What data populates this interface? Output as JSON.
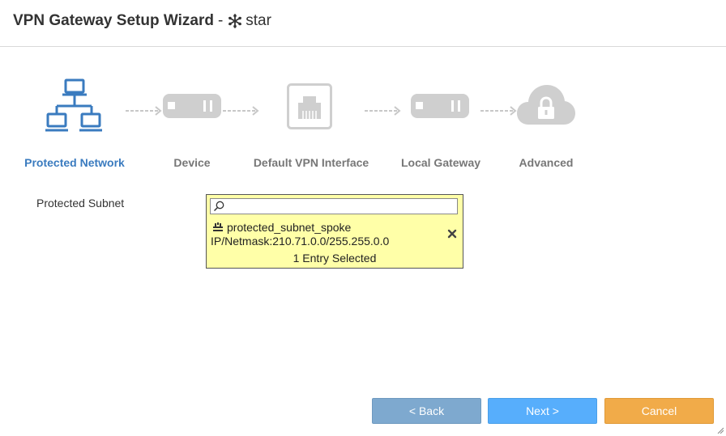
{
  "header": {
    "title": "VPN Gateway Setup Wizard",
    "separator": "-",
    "device_icon": "snowflake-icon",
    "device_name": "star"
  },
  "steps": [
    {
      "label": "Protected Network",
      "icon": "network-icon",
      "active": true
    },
    {
      "label": "Device",
      "icon": "device-icon",
      "active": false
    },
    {
      "label": "Default VPN Interface",
      "icon": "ethernet-port-icon",
      "active": false
    },
    {
      "label": "Local Gateway",
      "icon": "gateway-icon",
      "active": false
    },
    {
      "label": "Advanced",
      "icon": "cloud-lock-icon",
      "active": false
    }
  ],
  "colors": {
    "active_step": "#3a7bbf",
    "inactive_step": "#cfcfcf",
    "selector_bg": "#ffffa8",
    "back_button": "#7ea9cf",
    "next_button": "#57aefc",
    "cancel_button": "#f1ab49"
  },
  "form": {
    "protected_subnet_label": "Protected Subnet",
    "search_value": "",
    "selected_entry": {
      "icon": "subnet-icon",
      "name": "protected_subnet_spoke",
      "ip_netmask": "IP/Netmask:210.71.0.0/255.255.0.0"
    },
    "selected_count": "1 Entry Selected"
  },
  "buttons": {
    "back": "< Back",
    "next": "Next >",
    "cancel": "Cancel"
  }
}
